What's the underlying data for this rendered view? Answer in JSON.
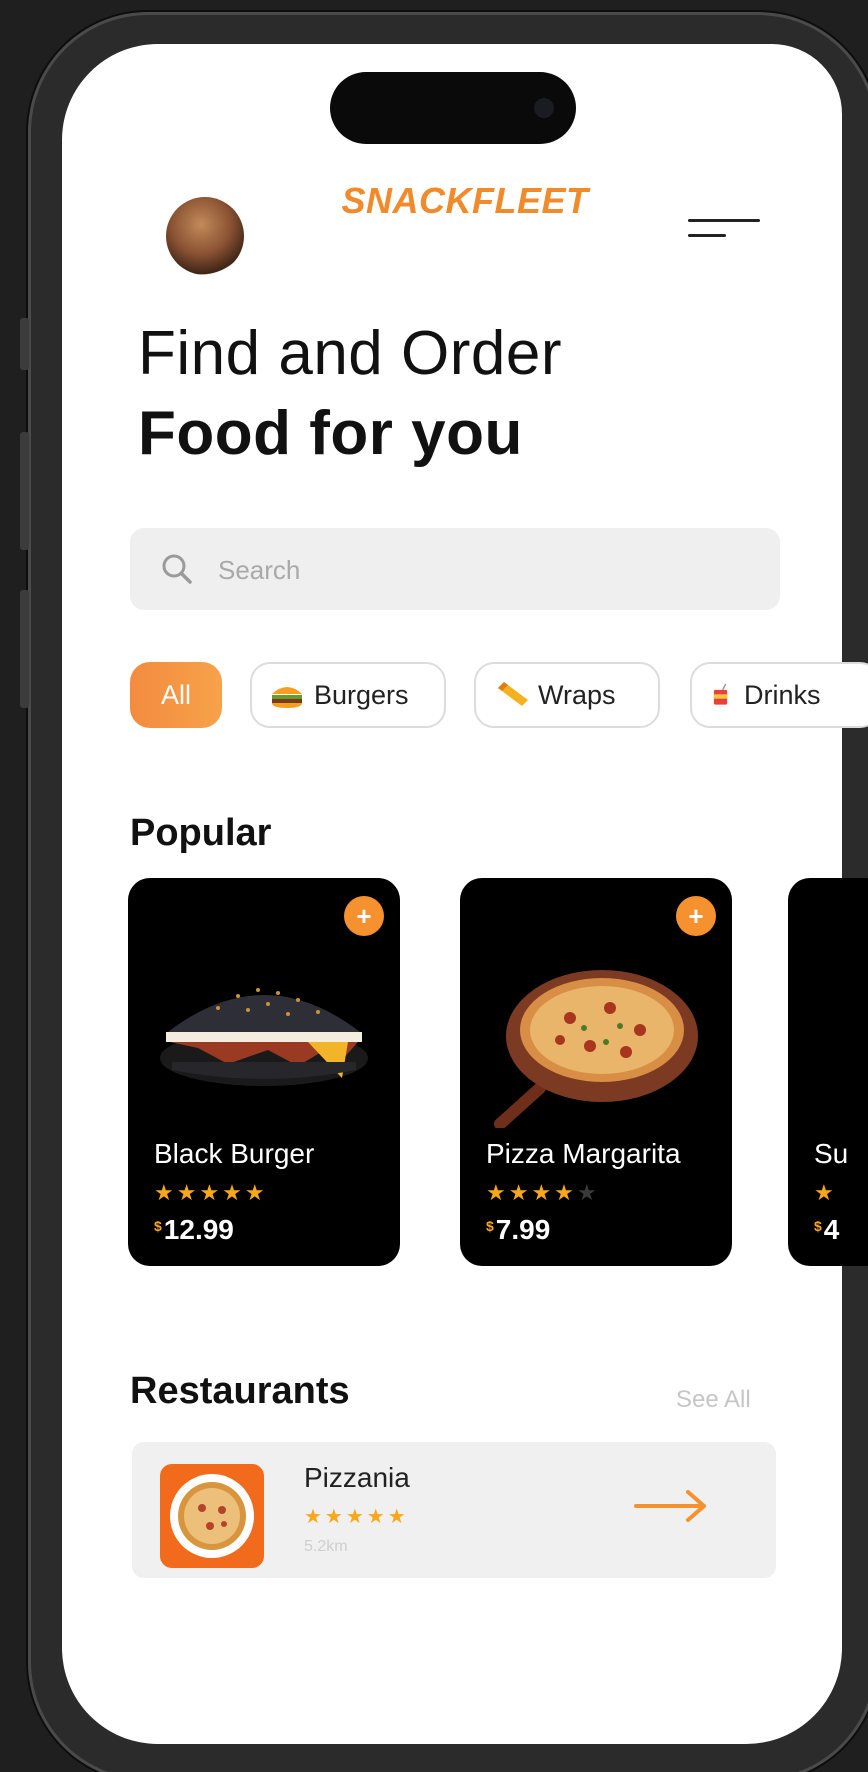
{
  "brand": "SNACKFLEET",
  "heading": {
    "line1": "Find and Order",
    "line2": "Food for you"
  },
  "search": {
    "placeholder": "Search",
    "value": ""
  },
  "categories": [
    {
      "label": "All",
      "icon": "none",
      "active": true
    },
    {
      "label": "Burgers",
      "icon": "burger-icon",
      "active": false
    },
    {
      "label": "Wraps",
      "icon": "wrap-icon",
      "active": false
    },
    {
      "label": "Drinks",
      "icon": "drink-icon",
      "active": false
    }
  ],
  "popular": {
    "title": "Popular",
    "items": [
      {
        "name": "Black Burger",
        "rating": 5,
        "currency": "$",
        "price": "12.99",
        "image": "black-burger-image"
      },
      {
        "name": "Pizza Margarita",
        "rating": 4,
        "currency": "$",
        "price": "7.99",
        "image": "pizza-image"
      },
      {
        "name": "Su",
        "rating": 1,
        "currency": "$",
        "price": "4",
        "image": "food-image"
      }
    ]
  },
  "restaurants": {
    "title": "Restaurants",
    "see_all": "See All",
    "items": [
      {
        "name": "Pizzania",
        "rating": 5,
        "distance": "5.2km"
      }
    ]
  },
  "colors": {
    "accent": "#f5922f",
    "star": "#f7a71c",
    "text": "#111111",
    "card_bg": "#000000"
  }
}
